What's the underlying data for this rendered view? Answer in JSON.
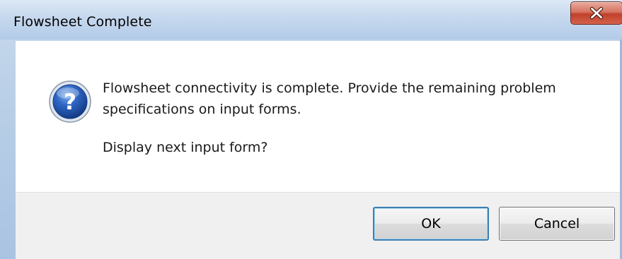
{
  "window": {
    "title": "Flowsheet Complete"
  },
  "title_bar": {
    "close_icon": "close-x-icon"
  },
  "dialog": {
    "icon": "question-icon",
    "message": "Flowsheet connectivity is complete. Provide the remaining problem specifications on input forms.",
    "prompt": "Display next input form?"
  },
  "buttons": {
    "ok_label": "OK",
    "cancel_label": "Cancel"
  },
  "colors": {
    "close_button_red": "#c0402b",
    "default_button_border": "#3c7fb1",
    "question_icon_blue": "#1f4fa3"
  }
}
